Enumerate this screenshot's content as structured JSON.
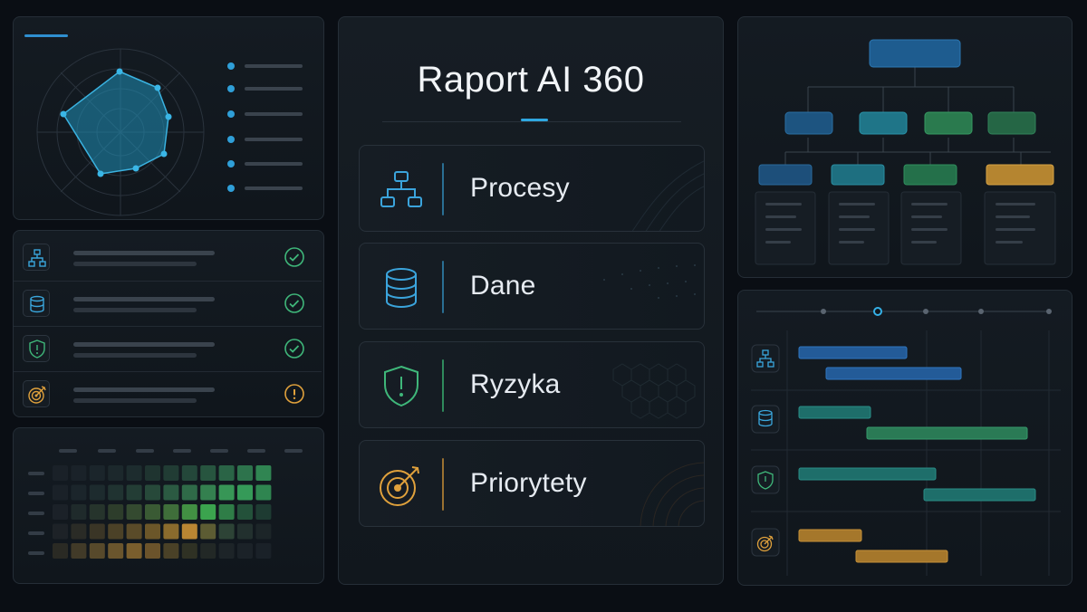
{
  "report": {
    "title": "Raport AI 360"
  },
  "categories": [
    {
      "id": "procesy",
      "label": "Procesy",
      "icon": "org-chart-icon",
      "color": "#3ba4dc"
    },
    {
      "id": "dane",
      "label": "Dane",
      "icon": "database-icon",
      "color": "#3ba4dc"
    },
    {
      "id": "ryzyka",
      "label": "Ryzyka",
      "icon": "shield-alert-icon",
      "color": "#3fb77a"
    },
    {
      "id": "priorytety",
      "label": "Priorytety",
      "icon": "target-icon",
      "color": "#e0a13c"
    }
  ],
  "checklist": [
    {
      "icon": "org-chart-icon",
      "status": "ok-icon"
    },
    {
      "icon": "database-icon",
      "status": "ok-icon"
    },
    {
      "icon": "shield-alert-icon",
      "status": "ok-icon"
    },
    {
      "icon": "target-icon",
      "status": "warning-icon"
    }
  ],
  "colors": {
    "background": "#0a0e14",
    "accent_blue": "#2f8fd0",
    "accent_teal": "#2aa6a6",
    "accent_green": "#3fb77a",
    "accent_amber": "#e0a13c"
  }
}
